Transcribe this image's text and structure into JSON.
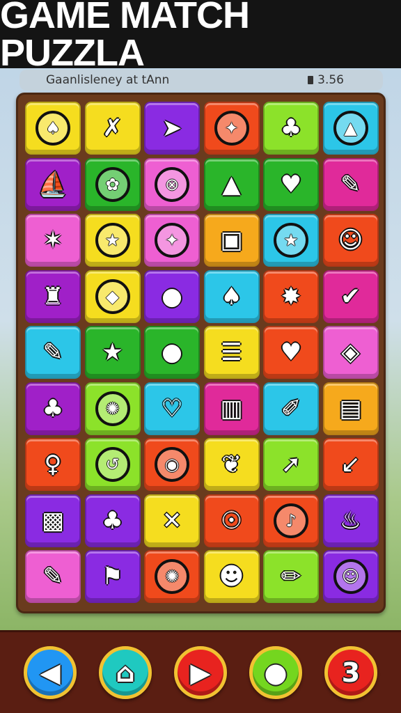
{
  "header": {
    "title": "GAME MATCH PUZZLA"
  },
  "info": {
    "left_text": "Gaanlisleney at tAnn",
    "right_text": "3.56",
    "timer_icon": "timer-icon"
  },
  "board": {
    "rows": [
      [
        {
          "icon": "mushroom-icon",
          "glyph": "♠",
          "bg": "#f5dd1f",
          "ring": true
        },
        {
          "icon": "leaf-icon",
          "glyph": "✗",
          "bg": "#f5dd1f",
          "ring": false
        },
        {
          "icon": "rocket-icon",
          "glyph": "➤",
          "bg": "#8a2be2",
          "ring": false
        },
        {
          "icon": "starfish-icon",
          "glyph": "✦",
          "bg": "#f04a1c",
          "ring": true
        },
        {
          "icon": "palm-icon",
          "glyph": "♣",
          "bg": "#8ce22a",
          "ring": false
        },
        {
          "icon": "pyramid-icon",
          "glyph": "▲",
          "bg": "#2cc6e8",
          "ring": true
        }
      ],
      [
        {
          "icon": "boat-icon",
          "glyph": "⛵",
          "bg": "#a020c8",
          "ring": false
        },
        {
          "icon": "flower-icon",
          "glyph": "✿",
          "bg": "#2ab52a",
          "ring": true
        },
        {
          "icon": "target-icon",
          "glyph": "⊗",
          "bg": "#ee5fd2",
          "ring": true
        },
        {
          "icon": "triangle-icon",
          "glyph": "▲",
          "bg": "#2ab52a",
          "ring": false
        },
        {
          "icon": "plant-icon",
          "glyph": "♥",
          "bg": "#2ab52a",
          "ring": false
        },
        {
          "icon": "pencil-icon",
          "glyph": "✎",
          "bg": "#e02a9a",
          "ring": false
        }
      ],
      [
        {
          "icon": "star-icon",
          "glyph": "✶",
          "bg": "#ee5fd2",
          "ring": false
        },
        {
          "icon": "star-badge-icon",
          "glyph": "★",
          "bg": "#f5dd1f",
          "ring": true
        },
        {
          "icon": "compass-icon",
          "glyph": "✦",
          "bg": "#ee5fd2",
          "ring": true
        },
        {
          "icon": "box-icon",
          "glyph": "▣",
          "bg": "#f6a91c",
          "ring": false
        },
        {
          "icon": "star-badge-icon",
          "glyph": "★",
          "bg": "#2cc6e8",
          "ring": true
        },
        {
          "icon": "robot-icon",
          "glyph": "☺",
          "bg": "#f04a1c",
          "ring": false
        }
      ],
      [
        {
          "icon": "bottle-icon",
          "glyph": "♜",
          "bg": "#a020c8",
          "ring": false
        },
        {
          "icon": "chip-icon",
          "glyph": "◆",
          "bg": "#f5dd1f",
          "ring": true
        },
        {
          "icon": "balloon-icon",
          "glyph": "●",
          "bg": "#8a2be2",
          "ring": false
        },
        {
          "icon": "leaf-icon",
          "glyph": "♠",
          "bg": "#2cc6e8",
          "ring": false
        },
        {
          "icon": "splash-icon",
          "glyph": "✸",
          "bg": "#f04a1c",
          "ring": false
        },
        {
          "icon": "check-icon",
          "glyph": "✔",
          "bg": "#e02a9a",
          "ring": false
        }
      ],
      [
        {
          "icon": "ruler-icon",
          "glyph": "✎",
          "bg": "#2cc6e8",
          "ring": false
        },
        {
          "icon": "star-icon",
          "glyph": "★",
          "bg": "#2ab52a",
          "ring": false
        },
        {
          "icon": "pin-icon",
          "glyph": "●",
          "bg": "#2ab52a",
          "ring": false
        },
        {
          "icon": "burger-icon",
          "glyph": "☰",
          "bg": "#f5dd1f",
          "ring": false
        },
        {
          "icon": "heart-icon",
          "glyph": "♥",
          "bg": "#f04a1c",
          "ring": false
        },
        {
          "icon": "map-icon",
          "glyph": "◈",
          "bg": "#ee5fd2",
          "ring": false
        }
      ],
      [
        {
          "icon": "palm-icon",
          "glyph": "♣",
          "bg": "#a020c8",
          "ring": false
        },
        {
          "icon": "web-icon",
          "glyph": "✺",
          "bg": "#8ce22a",
          "ring": true
        },
        {
          "icon": "tool-icon",
          "glyph": "♡",
          "bg": "#2cc6e8",
          "ring": false
        },
        {
          "icon": "chart-icon",
          "glyph": "▥",
          "bg": "#e02a9a",
          "ring": false
        },
        {
          "icon": "brush-icon",
          "glyph": "✐",
          "bg": "#2cc6e8",
          "ring": false
        },
        {
          "icon": "radio-icon",
          "glyph": "▤",
          "bg": "#f6a91c",
          "ring": false
        }
      ],
      [
        {
          "icon": "key-icon",
          "glyph": "♀",
          "bg": "#f04a1c",
          "ring": false
        },
        {
          "icon": "ring-icon",
          "glyph": "↺",
          "bg": "#8ce22a",
          "ring": true
        },
        {
          "icon": "helmet-icon",
          "glyph": "◉",
          "bg": "#f04a1c",
          "ring": true
        },
        {
          "icon": "feather-icon",
          "glyph": "❦",
          "bg": "#f5dd1f",
          "ring": false
        },
        {
          "icon": "arrow-icon",
          "glyph": "➚",
          "bg": "#8ce22a",
          "ring": false
        },
        {
          "icon": "knife-icon",
          "glyph": "↙",
          "bg": "#f04a1c",
          "ring": false
        }
      ],
      [
        {
          "icon": "chest-icon",
          "glyph": "▩",
          "bg": "#8a2be2",
          "ring": false
        },
        {
          "icon": "palm-icon",
          "glyph": "♣",
          "bg": "#8a2be2",
          "ring": false
        },
        {
          "icon": "bone-icon",
          "glyph": "✕",
          "bg": "#f5dd1f",
          "ring": false
        },
        {
          "icon": "bug-icon",
          "glyph": "☉",
          "bg": "#f04a1c",
          "ring": false
        },
        {
          "icon": "swan-icon",
          "glyph": "♪",
          "bg": "#f04a1c",
          "ring": true
        },
        {
          "icon": "jar-icon",
          "glyph": "♨",
          "bg": "#8a2be2",
          "ring": false
        }
      ],
      [
        {
          "icon": "slate-icon",
          "glyph": "✎",
          "bg": "#ee5fd2",
          "ring": false
        },
        {
          "icon": "flag-icon",
          "glyph": "⚑",
          "bg": "#8a2be2",
          "ring": false
        },
        {
          "icon": "crab-icon",
          "glyph": "✺",
          "bg": "#f04a1c",
          "ring": true
        },
        {
          "icon": "monkey-icon",
          "glyph": "☻",
          "bg": "#f5dd1f",
          "ring": false
        },
        {
          "icon": "spoon-icon",
          "glyph": "✏",
          "bg": "#8ce22a",
          "ring": false
        },
        {
          "icon": "face-icon",
          "glyph": "☺",
          "bg": "#8a2be2",
          "ring": true
        }
      ]
    ]
  },
  "controls": [
    {
      "name": "back-button",
      "icon": "back-arrow-icon",
      "glyph": "◀",
      "color": "#2196f3"
    },
    {
      "name": "home-button",
      "icon": "home-icon",
      "glyph": "⌂",
      "color": "#1fc9c0"
    },
    {
      "name": "play-button",
      "icon": "play-icon",
      "glyph": "▶",
      "color": "#e8231f"
    },
    {
      "name": "chat-button",
      "icon": "chat-bubble-icon",
      "glyph": "●",
      "color": "#74d61f"
    },
    {
      "name": "level-button",
      "icon": "number-icon",
      "glyph": "3",
      "color": "#e8231f"
    }
  ]
}
